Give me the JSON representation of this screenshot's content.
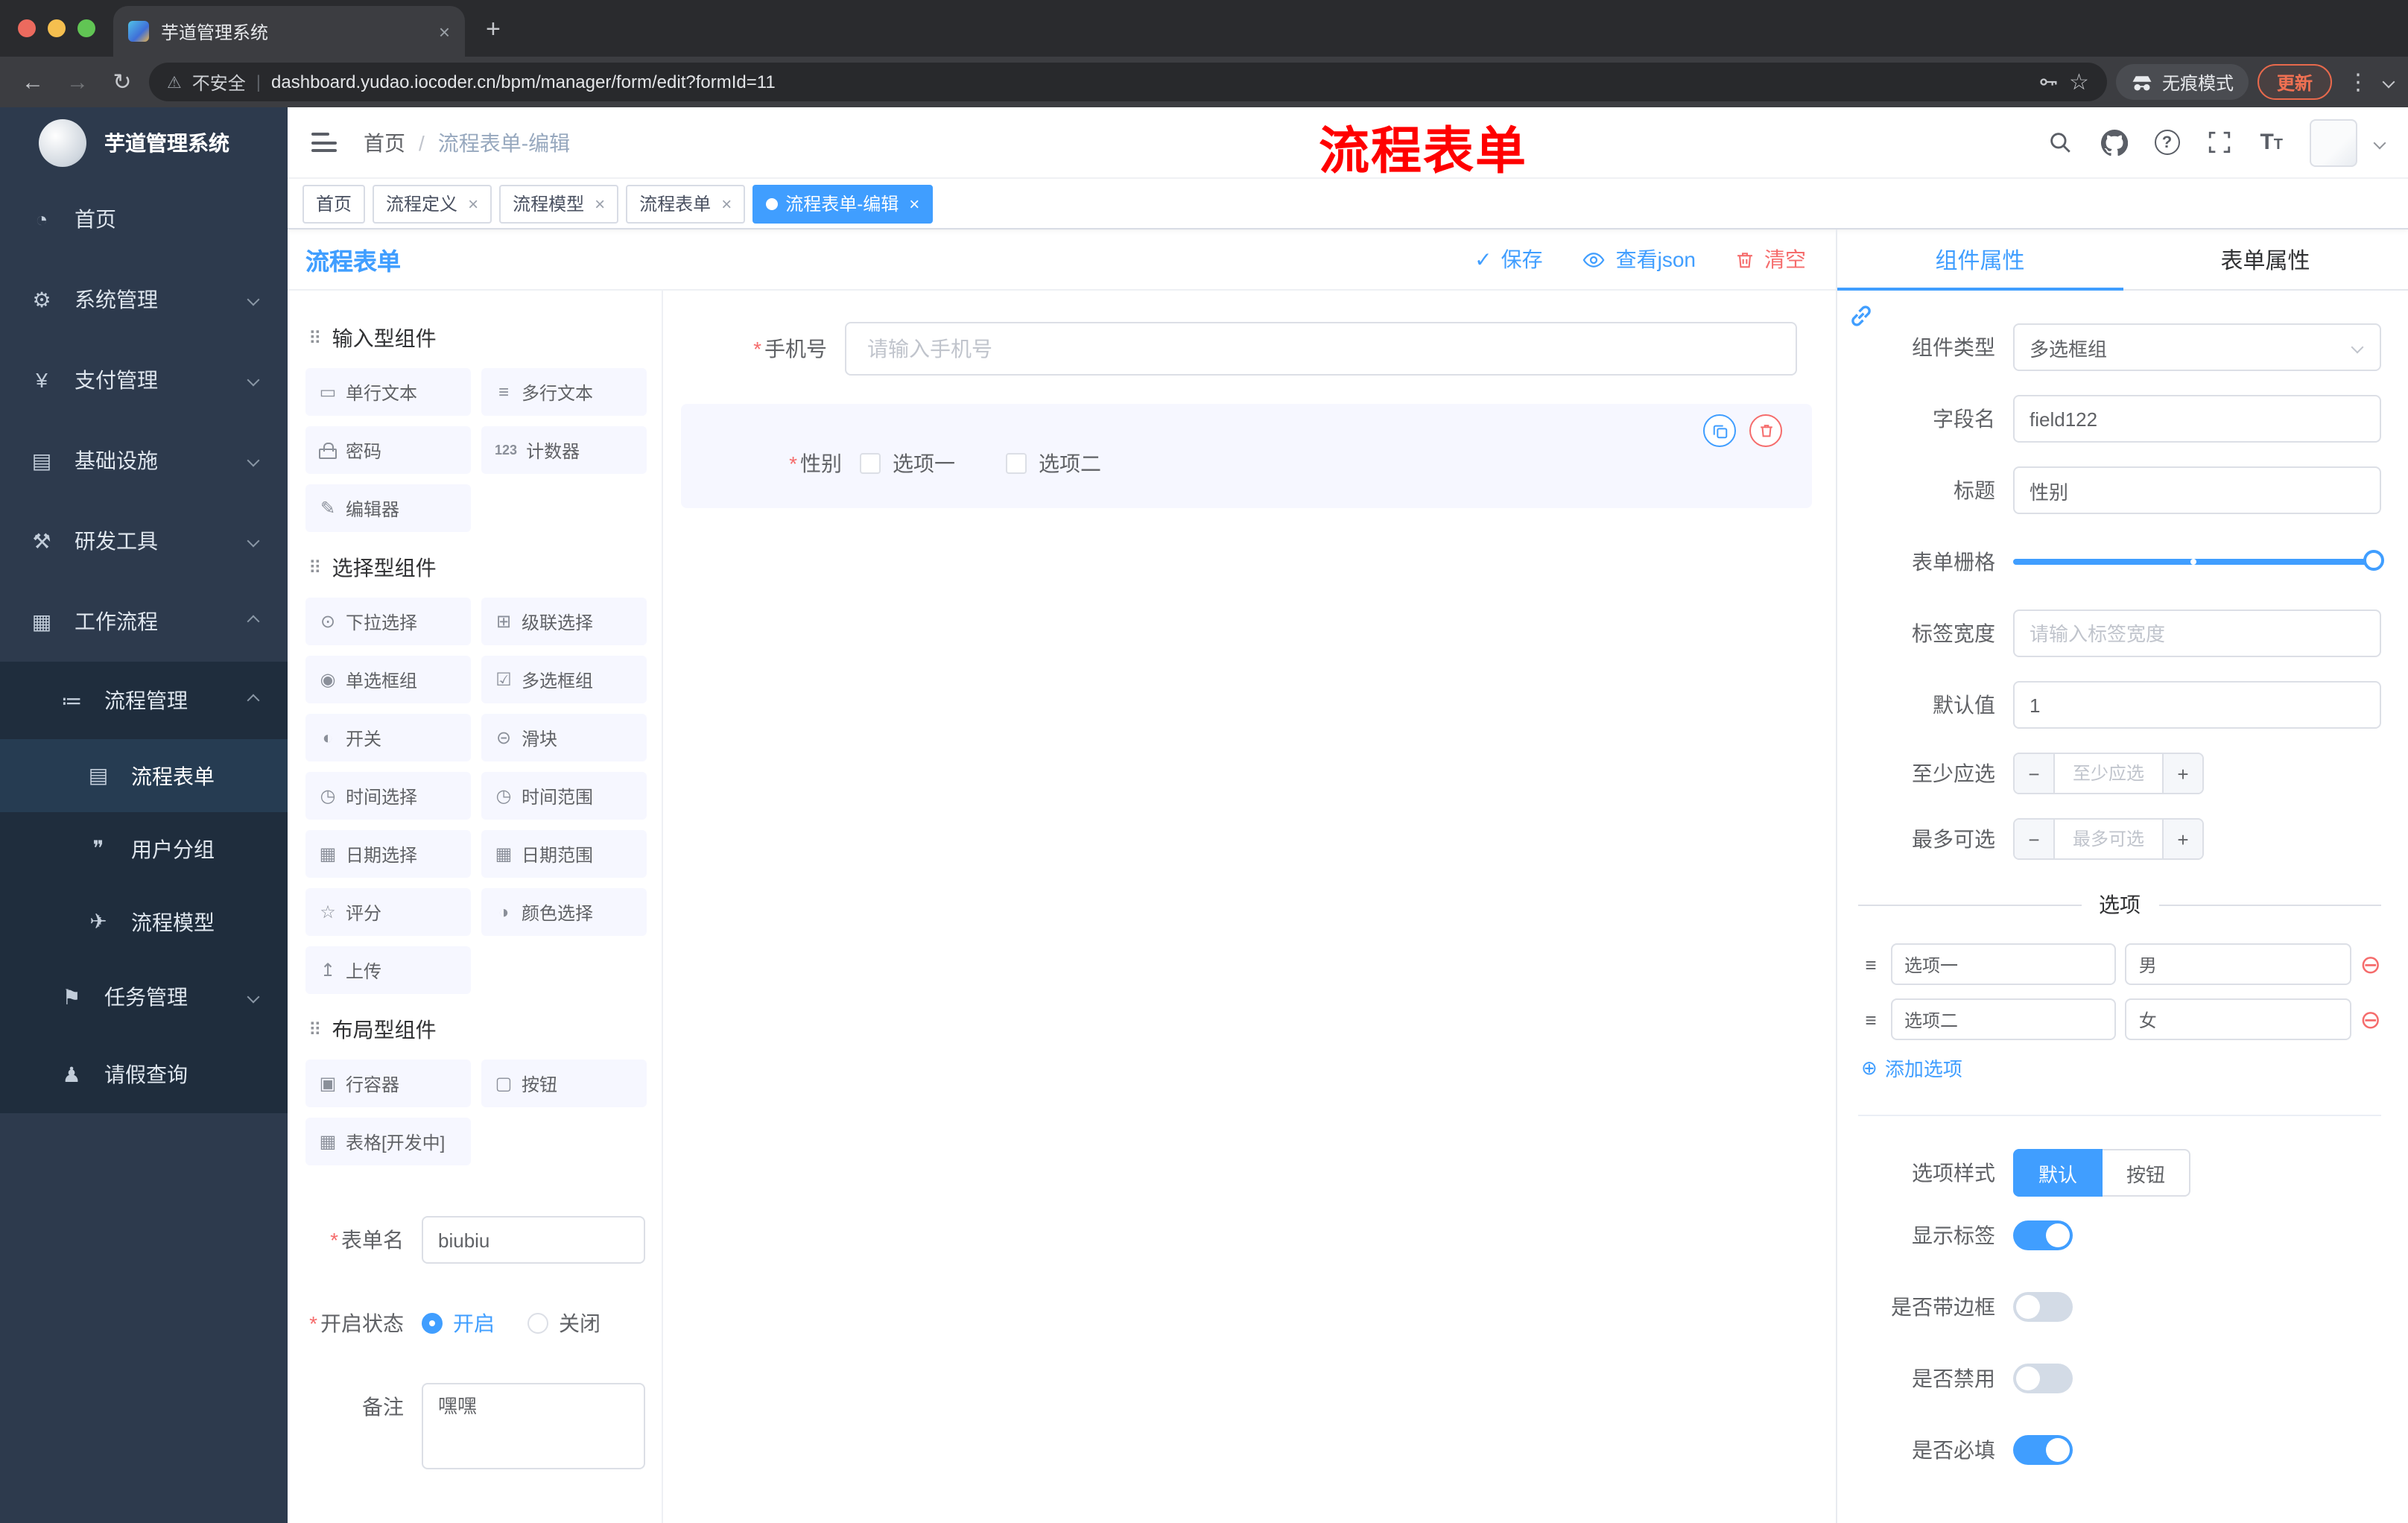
{
  "browser": {
    "tab_title": "芋道管理系统",
    "new_tab_icon": "+",
    "close_icon": "×",
    "back_icon": "←",
    "forward_icon": "→",
    "reload_icon": "↻",
    "warning_icon": "⚠",
    "security_label": "不安全",
    "url": "dashboard.yudao.iocoder.cn/bpm/manager/form/edit?formId=11",
    "star_icon": "☆",
    "incognito_label": "无痕模式",
    "update_label": "更新",
    "kebab_icon": "⋮"
  },
  "header": {
    "breadcrumb": {
      "home": "首页",
      "separator": "/",
      "current": "流程表单-编辑"
    },
    "annotation": "流程表单",
    "question_mark": "?"
  },
  "tags": {
    "close_icon": "×",
    "items": [
      {
        "label": "首页"
      },
      {
        "label": "流程定义"
      },
      {
        "label": "流程模型"
      },
      {
        "label": "流程表单"
      },
      {
        "label": "流程表单-编辑"
      }
    ]
  },
  "sidebar": {
    "logo_title": "芋道管理系统",
    "menu": [
      {
        "label": "首页",
        "icon": "◔"
      },
      {
        "label": "系统管理",
        "icon": "⚙"
      },
      {
        "label": "支付管理",
        "icon": "¥"
      },
      {
        "label": "基础设施",
        "icon": "▤"
      },
      {
        "label": "研发工具",
        "icon": "⚒"
      },
      {
        "label": "工作流程",
        "icon": "▦"
      }
    ],
    "process_mgmt": {
      "label": "流程管理",
      "icon": "≔"
    },
    "process_children": [
      {
        "label": "流程表单",
        "icon": "▤"
      },
      {
        "label": "用户分组",
        "icon": "❞"
      },
      {
        "label": "流程模型",
        "icon": "✈"
      }
    ],
    "task_mgmt": {
      "label": "任务管理",
      "icon": "⚑"
    },
    "leave": {
      "label": "请假查询",
      "icon": "♟"
    }
  },
  "designer": {
    "title": "流程表单",
    "toolbar": {
      "check_icon": "✓",
      "save": "保存",
      "view_json": "查看json",
      "clear": "清空"
    }
  },
  "palette": {
    "groups": [
      {
        "icon": "⠿",
        "title": "输入型组件",
        "items": [
          {
            "icon": "▭",
            "label": "单行文本"
          },
          {
            "icon": "≡",
            "label": "多行文本"
          },
          {
            "icon": "",
            "label": "密码"
          },
          {
            "icon": "123",
            "label": "计数器"
          },
          {
            "icon": "✎",
            "label": "编辑器"
          }
        ]
      },
      {
        "icon": "⠿",
        "title": "选择型组件",
        "items": [
          {
            "icon": "⊙",
            "label": "下拉选择"
          },
          {
            "icon": "⊞",
            "label": "级联选择"
          },
          {
            "icon": "◉",
            "label": "单选框组"
          },
          {
            "icon": "☑",
            "label": "多选框组"
          },
          {
            "icon": "◐",
            "label": "开关"
          },
          {
            "icon": "⊝",
            "label": "滑块"
          },
          {
            "icon": "◷",
            "label": "时间选择"
          },
          {
            "icon": "◷",
            "label": "时间范围"
          },
          {
            "icon": "▦",
            "label": "日期选择"
          },
          {
            "icon": "▦",
            "label": "日期范围"
          },
          {
            "icon": "☆",
            "label": "评分"
          },
          {
            "icon": "◑",
            "label": "颜色选择"
          },
          {
            "icon": "↥",
            "label": "上传"
          }
        ]
      },
      {
        "icon": "⠿",
        "title": "布局型组件",
        "items": [
          {
            "icon": "▣",
            "label": "行容器"
          },
          {
            "icon": "▢",
            "label": "按钮"
          },
          {
            "icon": "▦",
            "label": "表格[开发中]"
          }
        ]
      }
    ],
    "meta": {
      "name_label": "表单名",
      "name_value": "biubiu",
      "status_label": "开启状态",
      "status_on": "开启",
      "status_off": "关闭",
      "remark_label": "备注",
      "remark_value": "嘿嘿"
    }
  },
  "canvas": {
    "phone": {
      "label": "手机号",
      "placeholder": "请输入手机号"
    },
    "gender": {
      "label": "性别",
      "option1": "选项一",
      "option2": "选项二"
    }
  },
  "inspector": {
    "tab_component": "组件属性",
    "tab_form": "表单属性",
    "type_label": "组件类型",
    "type_value": "多选框组",
    "field_label": "字段名",
    "field_value": "field122",
    "title_label": "标题",
    "title_value": "性别",
    "grid_label": "表单栅格",
    "label_width_label": "标签宽度",
    "label_width_placeholder": "请输入标签宽度",
    "default_label": "默认值",
    "default_value": "1",
    "min_label": "至少应选",
    "min_placeholder": "至少应选",
    "max_label": "最多可选",
    "max_placeholder": "最多可选",
    "minus": "−",
    "plus": "+",
    "options_title": "选项",
    "drag_icon": "≡",
    "remove_icon": "⊖",
    "add_icon": "⊕",
    "options": [
      {
        "label": "选项一",
        "value": "男"
      },
      {
        "label": "选项二",
        "value": "女"
      }
    ],
    "add_option": "添加选项",
    "style_label": "选项样式",
    "style_default": "默认",
    "style_button": "按钮",
    "switch_show_label": "显示标签",
    "switch_border": "是否带边框",
    "switch_disabled": "是否禁用",
    "switch_required": "是否必填"
  }
}
